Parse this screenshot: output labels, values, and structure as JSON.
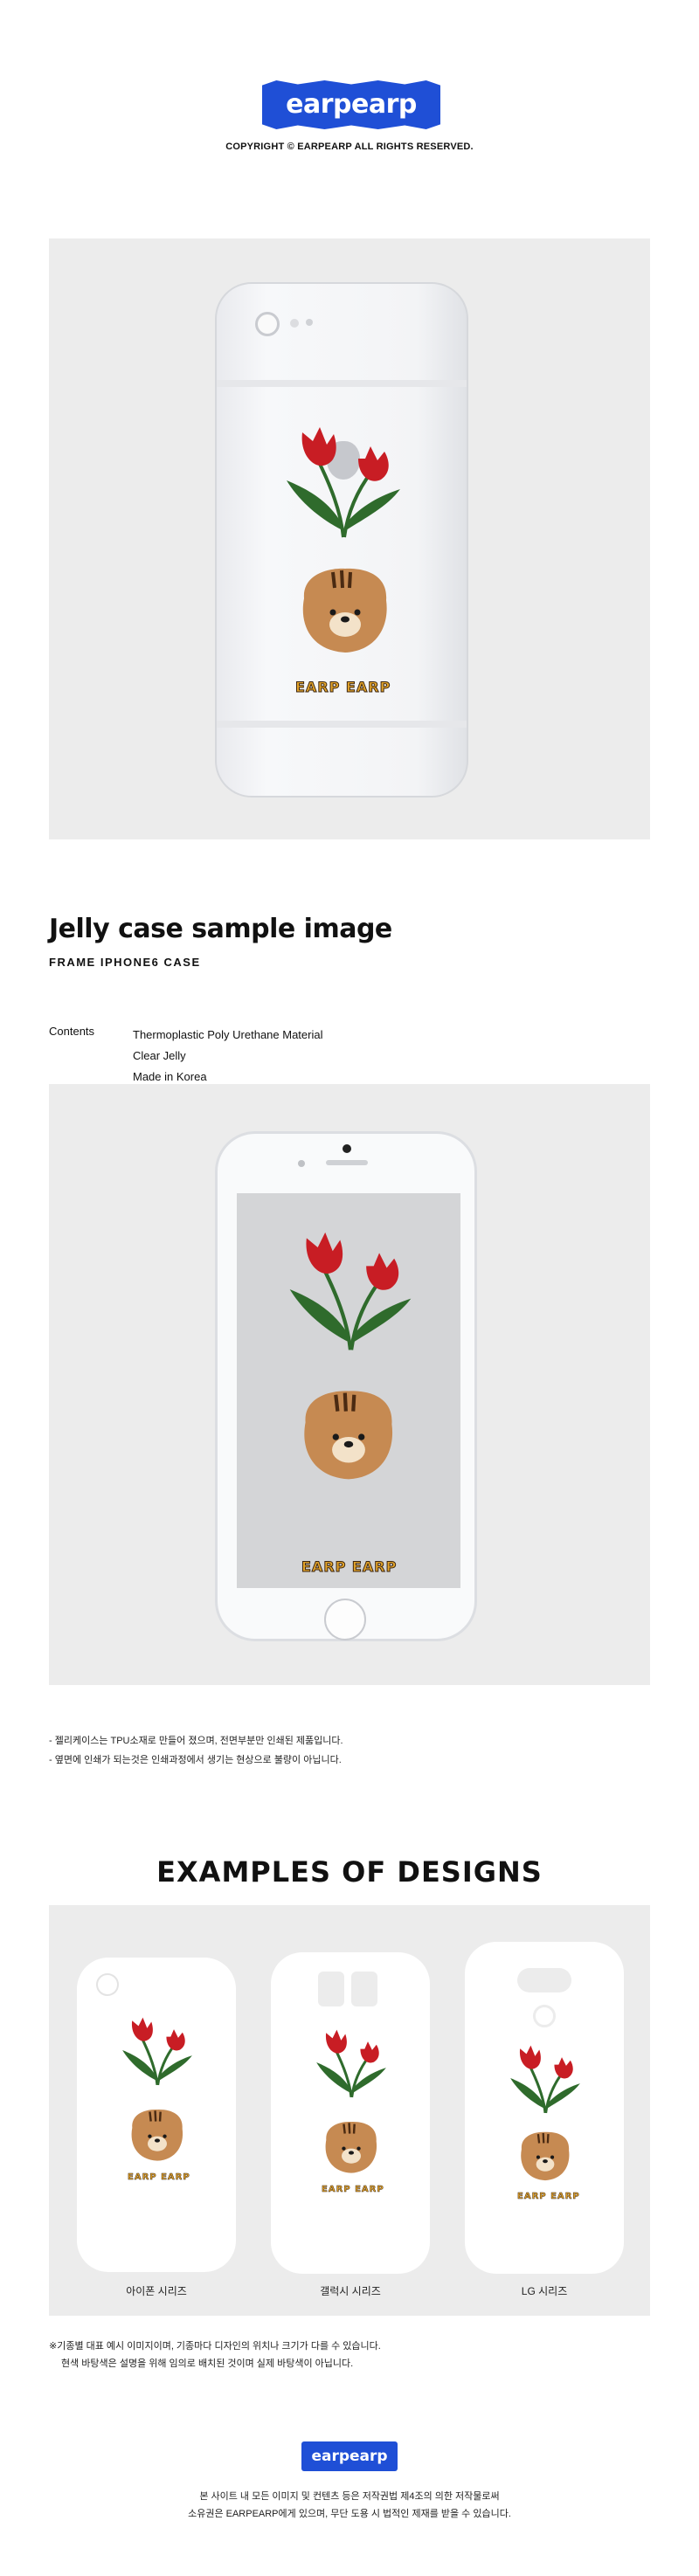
{
  "header": {
    "logo_text": "earpearp",
    "copyright": "COPYRIGHT © EARPEARP ALL RIGHTS RESERVED."
  },
  "design": {
    "brand_mark": "EARP EARP",
    "colors": {
      "accent_blue": "#1f4fd6",
      "tulip_red": "#c81d24",
      "leaf_green": "#2f6b2c",
      "bear_brown": "#c68a52"
    }
  },
  "product": {
    "title": "Jelly case sample image",
    "subtitle": "FRAME IPHONE6 CASE",
    "contents_label": "Contents",
    "contents": [
      "Thermoplastic Poly Urethane Material",
      "Clear Jelly",
      "Made in Korea"
    ]
  },
  "notes": [
    "- 젤리케이스는 TPU소재로 만들어 졌으며, 전면부분만 인쇄된 제품입니다.",
    "- 옆면에 인쇄가 되는것은 인쇄과정에서 생기는 현상으로 불량이 아닙니다."
  ],
  "examples": {
    "title": "EXAMPLES OF DESIGNS",
    "labels": [
      "아이폰 시리즈",
      "갤럭시 시리즈",
      "LG 시리즈"
    ]
  },
  "bottom_note": [
    "※기종별 대표 예시 이미지이며, 기종마다 디자인의 위치나 크기가 다를 수 있습니다.",
    "현색 바탕색은 설명을 위해 임의로 배치된 것이며 실제 바탕색이 아닙니다."
  ],
  "footer": {
    "logo_text": "earpearp",
    "lines": [
      "본 사이트 내 모든 이미지 및 컨텐츠 등은 저작권법 제4조의 의한 저작물로써",
      "소유권은 EARPEARP에게 있으며, 무단 도용 시 법적인 제재를 받을 수 있습니다."
    ]
  }
}
